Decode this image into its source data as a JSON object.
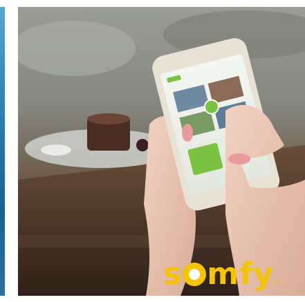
{
  "logo": {
    "part1": "s",
    "part2": "mfy",
    "registered": "®",
    "color": "#f5c400"
  },
  "scene": {
    "colors": {
      "table": "#4a3426",
      "phone_body": "#e8e2d6",
      "screen_accent": "#7cc242"
    }
  }
}
